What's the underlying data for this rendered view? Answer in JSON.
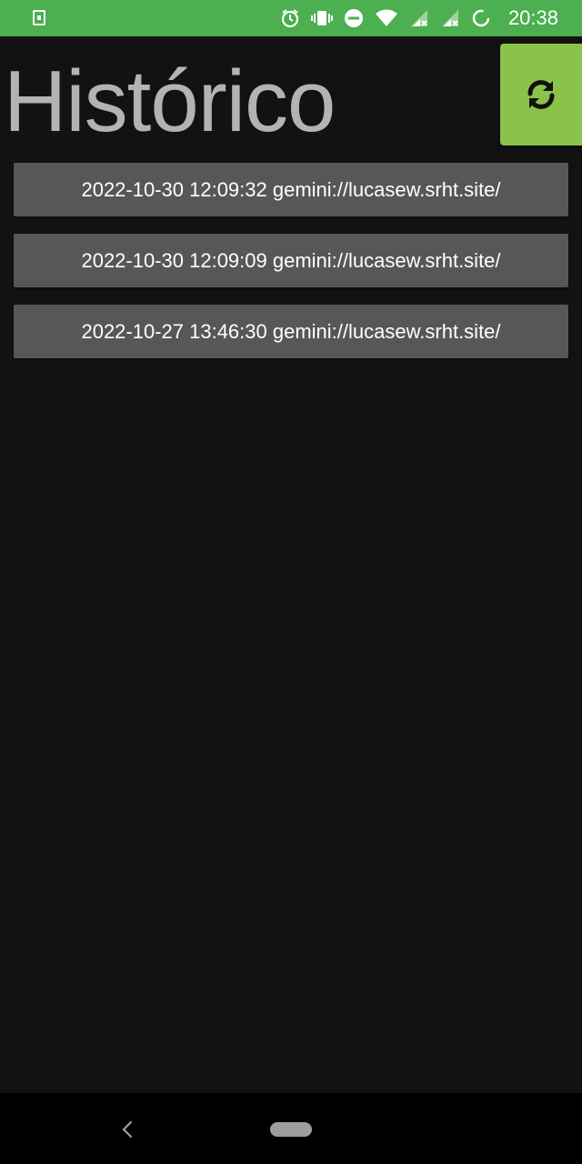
{
  "status_bar": {
    "time": "20:38",
    "icons": [
      "notification-icon",
      "alarm-icon",
      "vibrate-icon",
      "do-not-disturb-icon",
      "wifi-icon",
      "signal-icon",
      "signal-icon-2",
      "battery-icon"
    ]
  },
  "header": {
    "title": "Histórico",
    "refresh_icon": "refresh-icon"
  },
  "history": [
    {
      "label": "2022-10-30 12:09:32 gemini://lucasew.srht.site/"
    },
    {
      "label": "2022-10-30 12:09:09 gemini://lucasew.srht.site/"
    },
    {
      "label": "2022-10-27 13:46:30 gemini://lucasew.srht.site/"
    }
  ],
  "nav": {
    "back_icon": "back-icon",
    "home_icon": "home-pill-icon"
  },
  "colors": {
    "status_bar": "#4caf50",
    "refresh_button": "#8bc34a",
    "background": "#121212",
    "item": "#575757",
    "title": "#b3b3b3"
  }
}
